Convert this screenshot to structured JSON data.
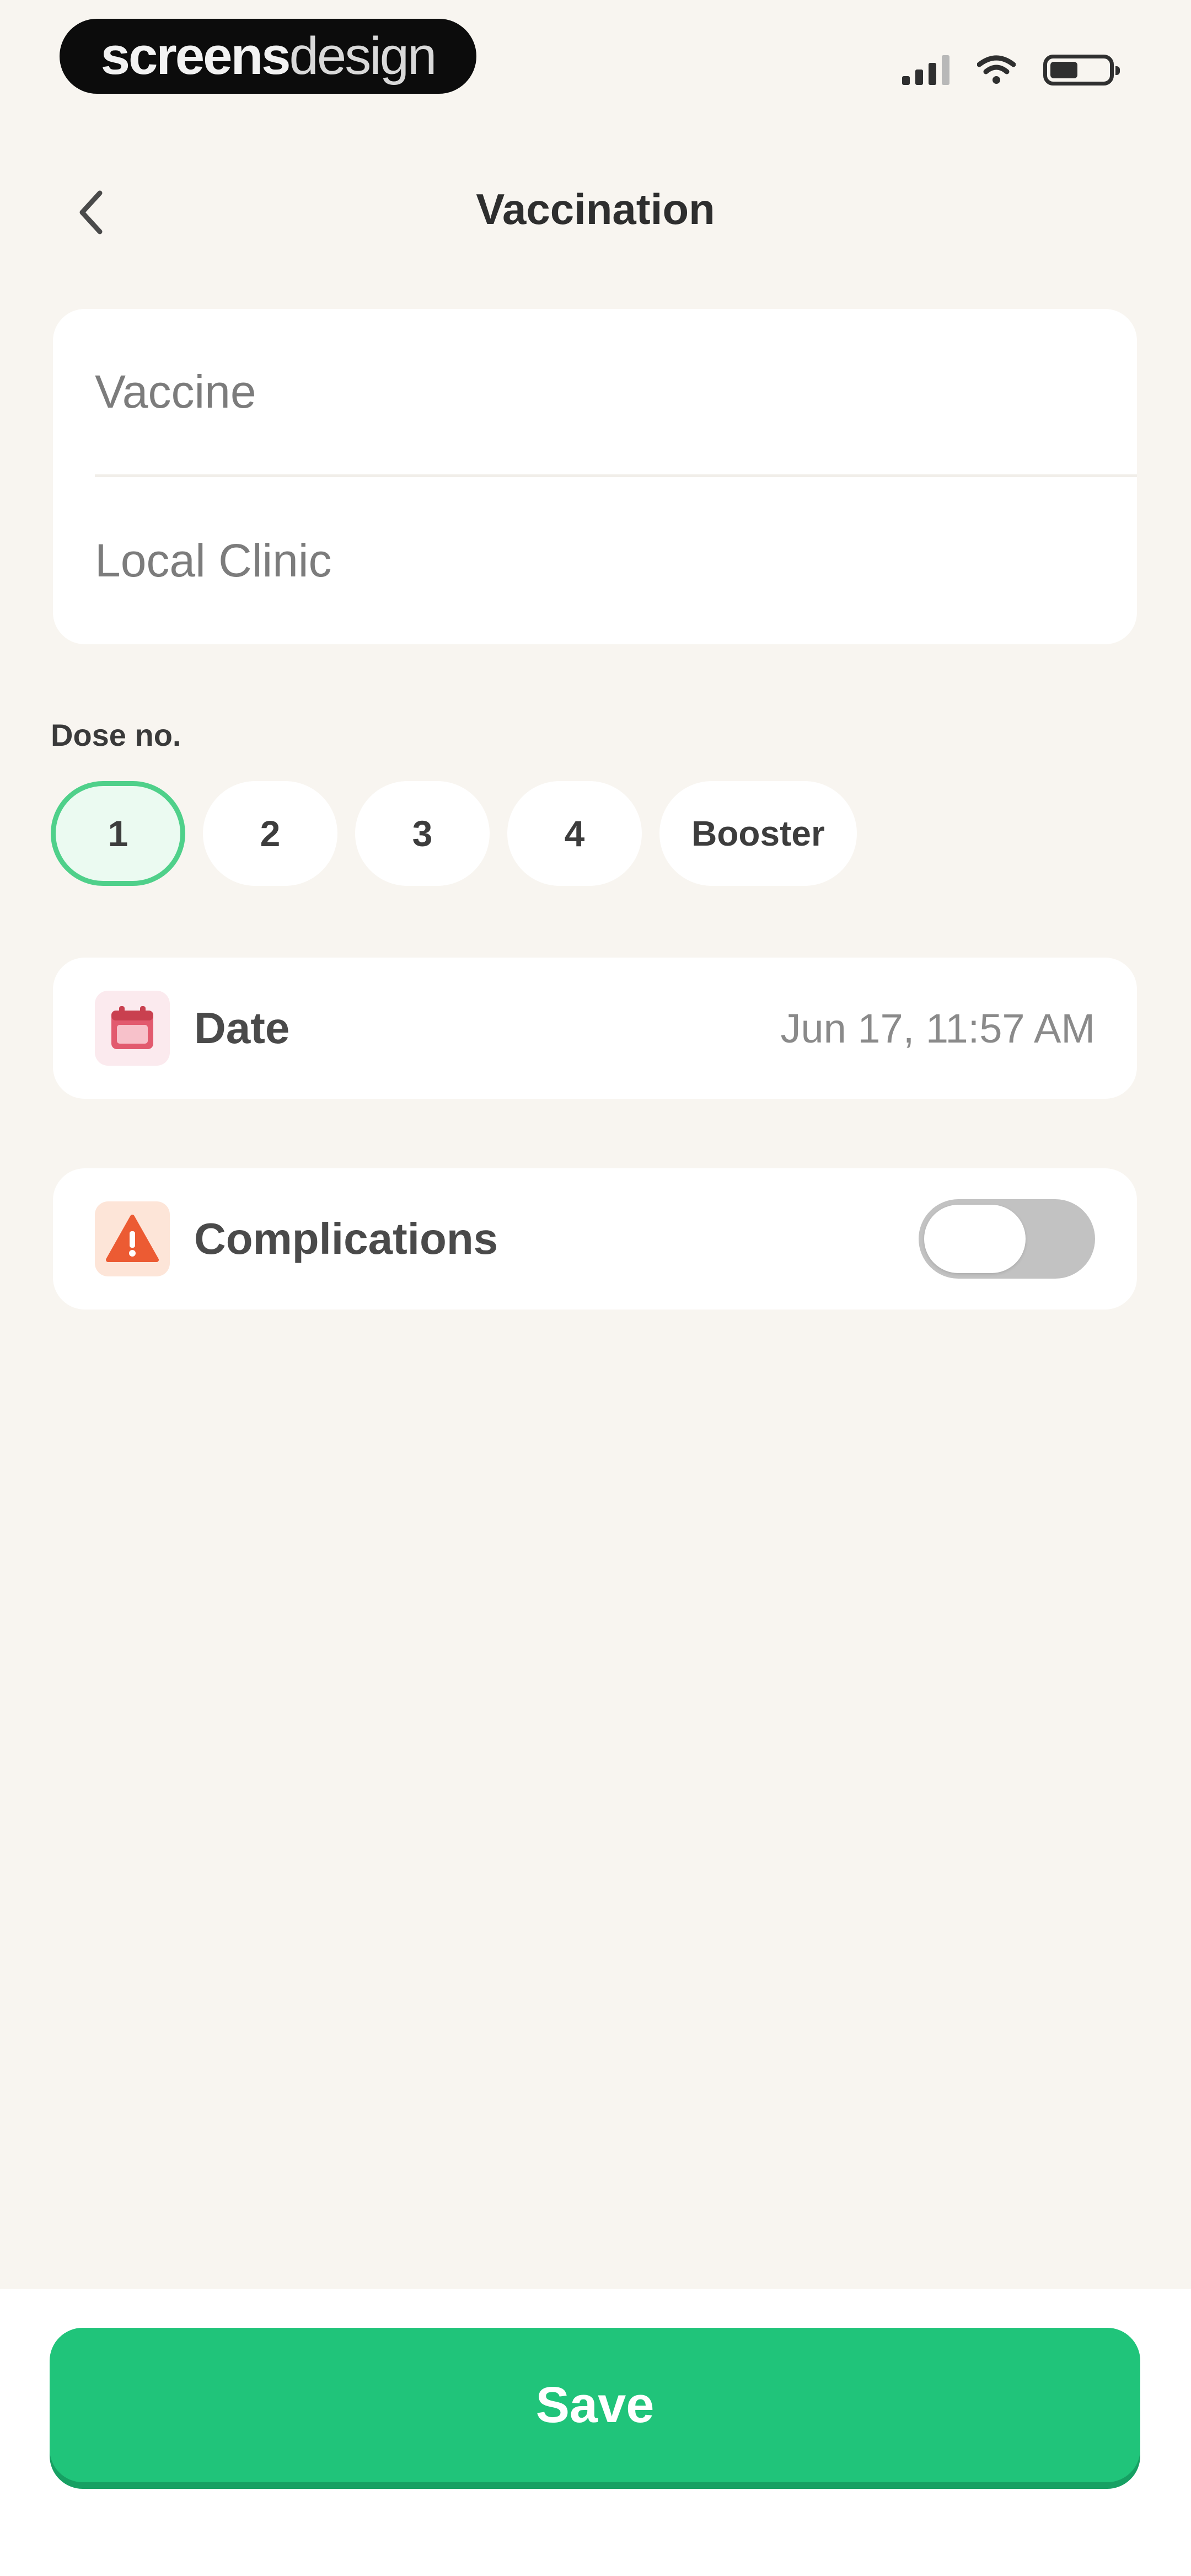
{
  "status_bar": {
    "brand_bold": "screens",
    "brand_light": "design",
    "signal_icon": "cellular-signal-icon",
    "wifi_icon": "wifi-icon",
    "battery_icon": "battery-icon",
    "battery_level": 0.48
  },
  "header": {
    "back_icon": "chevron-left-icon",
    "title": "Vaccination"
  },
  "form": {
    "vaccine_placeholder": "Vaccine",
    "clinic_placeholder": "Local Clinic"
  },
  "dose": {
    "label": "Dose no.",
    "options": [
      "1",
      "2",
      "3",
      "4",
      "Booster"
    ],
    "selected": "1"
  },
  "date_row": {
    "icon": "calendar-icon",
    "label": "Date",
    "value": "Jun 17, 11:57 AM"
  },
  "complications_row": {
    "icon": "warning-icon",
    "label": "Complications",
    "toggle_on": false
  },
  "save_button": {
    "label": "Save"
  },
  "colors": {
    "background": "#f8f5f0",
    "card": "#ffffff",
    "accent_green": "#20c47a",
    "selected_border": "#4fd08a",
    "calendar_red": "#e25a6e",
    "warning_orange": "#ec5b33"
  }
}
